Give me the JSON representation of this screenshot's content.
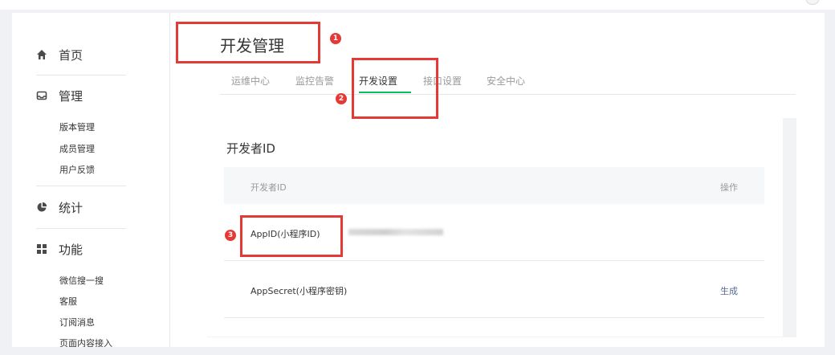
{
  "sidebar": {
    "home": {
      "label": "首页",
      "icon": "home-icon"
    },
    "manage": {
      "label": "管理",
      "icon": "inbox-icon",
      "items": [
        "版本管理",
        "成员管理",
        "用户反馈"
      ]
    },
    "stats": {
      "label": "统计",
      "icon": "pie-chart-icon"
    },
    "features": {
      "label": "功能",
      "icon": "grid-icon",
      "items": [
        "微信搜一搜",
        "客服",
        "订阅消息",
        "页面内容接入"
      ]
    }
  },
  "main": {
    "title": "开发管理",
    "tabs": [
      "运维中心",
      "监控告警",
      "开发设置",
      "接口设置",
      "安全中心"
    ],
    "active_tab": "开发设置",
    "card": {
      "title": "开发者ID",
      "columns": [
        "开发者ID",
        "操作"
      ],
      "rows": [
        {
          "label": "AppID(小程序ID)",
          "action": ""
        },
        {
          "label": "AppSecret(小程序密钥)",
          "action": "生成"
        }
      ]
    }
  },
  "annotations": [
    "1",
    "2",
    "3"
  ],
  "colors": {
    "accent": "#07c160",
    "link": "#576b95",
    "annotation": "#e53935"
  }
}
